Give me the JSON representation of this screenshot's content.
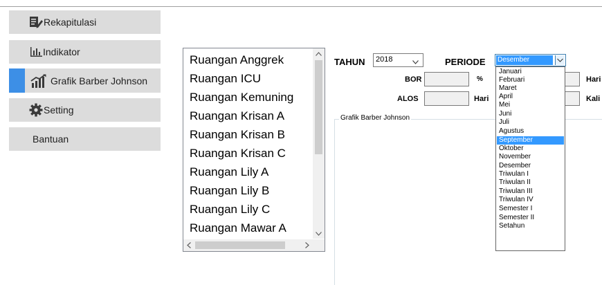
{
  "sidebar": {
    "items": [
      {
        "label": "Rekapitulasi"
      },
      {
        "label": "Indikator"
      },
      {
        "label": "Grafik Barber Johnson"
      },
      {
        "label": "Setting"
      },
      {
        "label": "Bantuan"
      }
    ]
  },
  "rooms": [
    "Ruangan Anggrek",
    "Ruangan ICU",
    "Ruangan Kemuning",
    "Ruangan Krisan A",
    "Ruangan Krisan B",
    "Ruangan Krisan C",
    "Ruangan Lily A",
    "Ruangan Lily B",
    "Ruangan Lily C",
    "Ruangan Mawar A"
  ],
  "filters": {
    "tahun_label": "TAHUN",
    "tahun_value": "2018",
    "periode_label": "PERIODE",
    "periode_value": "Desember"
  },
  "metrics": {
    "bor_label": "BOR",
    "bor_unit": "%",
    "alos_label": "ALOS",
    "alos_unit": "Hari",
    "right1_unit": "Hari",
    "right2_unit": "Kali"
  },
  "group_title": "Grafik Barber Johnson",
  "periode_options": [
    "Januari",
    "Februari",
    "Maret",
    "April",
    "Mei",
    "Juni",
    "Juli",
    "Agustus",
    "September",
    "Oktober",
    "November",
    "Desember",
    "Triwulan I",
    "Triwulan II",
    "Triwulan III",
    "Triwulan IV",
    "Semester I",
    "Semester II",
    "Setahun"
  ],
  "highlighted_option": "September",
  "colors": {
    "accent": "#3d8fe6",
    "selection": "#3399ff"
  }
}
